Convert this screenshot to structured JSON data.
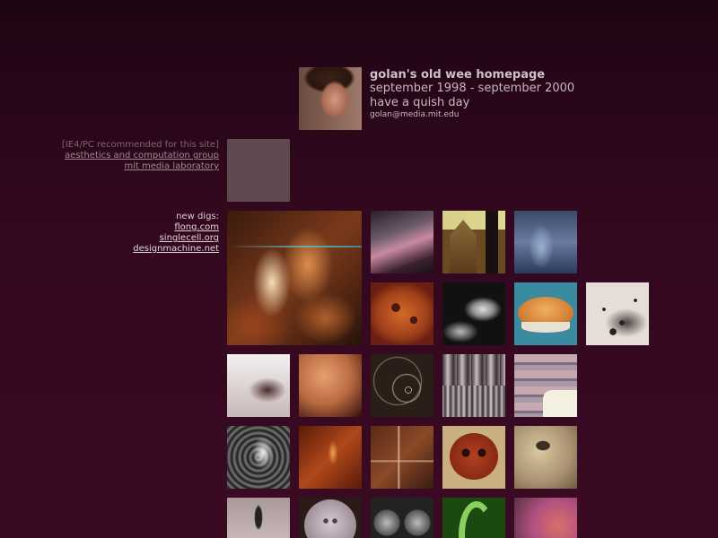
{
  "header": {
    "title": "golan's old wee homepage",
    "date_range": "september 1998 - september 2000",
    "tagline": "have a quish day",
    "email": "golan@media.mit.edu",
    "portrait_icon": "portrait-photo"
  },
  "info": {
    "note": "[IE4/PC recommended for this site]",
    "links": [
      "aesthetics and computation group",
      "mit media laboratory"
    ]
  },
  "digs": {
    "label": "new digs:",
    "links": [
      "flong.com",
      "singlecell.org",
      "designmachine.net"
    ]
  },
  "colors": {
    "background": "#33081f",
    "title_text": "#cfc2c6",
    "muted_text": "#7c6870",
    "link_text": "#e0d6d8"
  },
  "thumbnails": [
    "fire-tendrils",
    "pink-streak",
    "cathedral",
    "blue-plant",
    "orange-face",
    "dark-tube",
    "pie",
    "ink-splatter",
    "cracked-surface",
    "skin-texture",
    "swirl-lines",
    "vertical-stripes",
    "drawing-hand",
    "web-texture",
    "rust-texture",
    "wood-scratch",
    "cookie-face",
    "disc",
    "drop-shape",
    "shirt-button",
    "gray-spheres",
    "green-hook",
    "pink-swirl"
  ]
}
